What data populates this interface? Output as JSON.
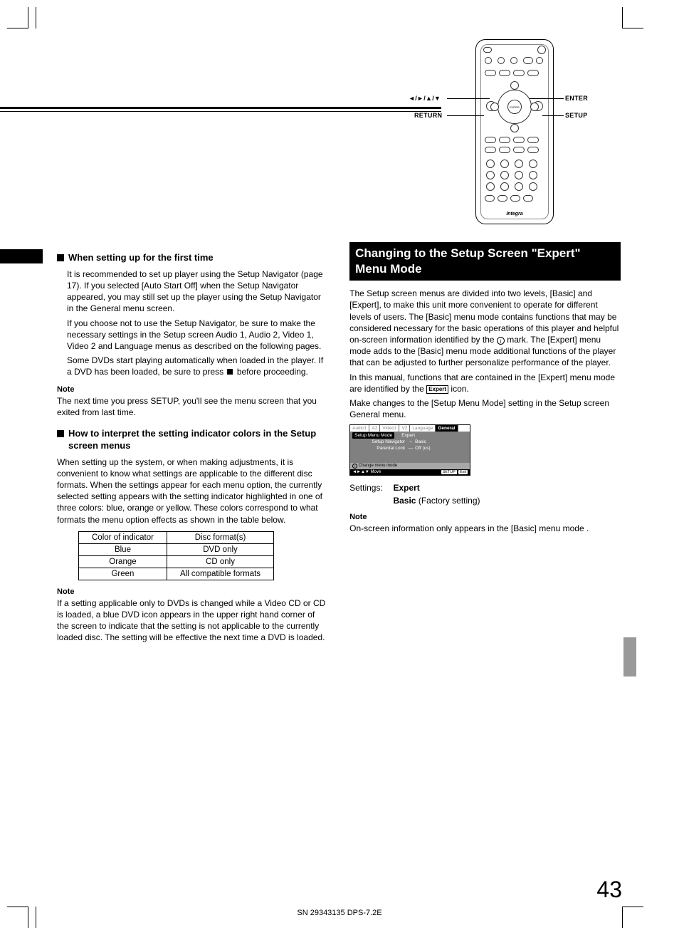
{
  "remote": {
    "label_arrows": "◄/►/▲/▼",
    "label_return": "RETURN",
    "label_enter": "ENTER",
    "label_setup": "SETUP",
    "brand": "Integra"
  },
  "left": {
    "h1": "When setting up for the first time",
    "p1": "It is recommended to set up player using the Setup Navigator (page 17). If you selected [Auto Start Off] when the Setup Navigator appeared, you may still set up the player using the Setup Navigator in the General menu screen.",
    "p2": "If you choose not to use the Setup Navigator, be sure to make the necessary settings in the Setup screen Audio 1, Audio 2, Video 1, Video 2 and Language menus as described on the following pages.",
    "p3a": "Some DVDs start playing automatically when loaded in the player. If a DVD has been loaded, be sure to press ",
    "p3b": " before proceeding.",
    "note1_h": "Note",
    "note1_p": "The next time you press SETUP, you'll see the menu screen that you exited from last time.",
    "h2": "How to interpret the setting indicator colors in the Setup screen menus",
    "p4": "When setting up the system, or when making adjustments, it is convenient to know what settings are applicable to the different disc formats. When the settings appear for each menu option, the currently selected setting appears with the setting indicator highlighted in one of three colors: blue, orange or yellow. These colors correspond to what formats the menu option effects as shown in the table below.",
    "table": {
      "h_color": "Color of indicator",
      "h_format": "Disc format(s)",
      "rows": [
        {
          "c": "Blue",
          "f": "DVD only"
        },
        {
          "c": "Orange",
          "f": "CD only"
        },
        {
          "c": "Green",
          "f": "All compatible formats"
        }
      ]
    },
    "note2_h": "Note",
    "note2_p": "If a setting applicable only to DVDs is changed while a Video CD or CD is loaded, a blue DVD icon appears in the upper right hand corner of the screen to indicate that the setting is not applicable to the currently loaded disc. The setting will be effective the next time a DVD is loaded."
  },
  "right": {
    "title": "Changing to the Setup Screen \"Expert\" Menu Mode",
    "p1a": "The Setup screen menus are divided into two levels, [Basic] and [Expert], to make this unit more convenient to operate for different levels of users. The [Basic] menu mode contains functions that may be considered necessary for the basic operations of this player and helpful on-screen information identified by the ",
    "p1b": " mark. The [Expert] menu mode adds to the [Basic] menu mode additional functions of the player that can be adjusted to further personalize performance of the player.",
    "p2a": "In this manual, functions that are contained in the [Expert] menu mode are identified by the ",
    "p2b": " icon.",
    "p3": "Make changes to the [Setup Menu Mode] setting in the Setup screen General menu.",
    "osd": {
      "tabs": [
        "Audio1",
        "A2",
        "Video1",
        "V2",
        "Language",
        "General"
      ],
      "active_tab": 5,
      "rows": [
        {
          "l": "Setup Menu Mode",
          "r": "Expert",
          "sel": true
        },
        {
          "l": "Setup Navigator",
          "r": "Basic",
          "sel": false
        },
        {
          "l": "Parental Lock",
          "r": "Off (us)",
          "sel": false
        }
      ],
      "hint": "Change menu mode",
      "foot_move": "Move",
      "foot_btn1": "SETUP",
      "foot_btn2": "Exit"
    },
    "settings_label": "Settings:",
    "settings_expert": "Expert",
    "settings_basic": "Basic",
    "settings_basic_note": " (Factory setting)",
    "note_h": "Note",
    "note_p": "On-screen information only appears in the [Basic] menu mode ."
  },
  "page_number": "43",
  "footer": "SN 29343135 DPS-7.2E"
}
